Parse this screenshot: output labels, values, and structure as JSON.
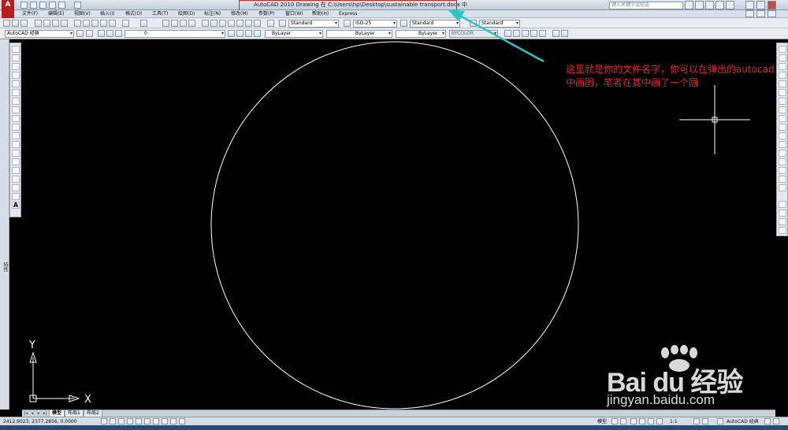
{
  "window": {
    "title": "AutoCAD 2010     Drawing 在 C:\\Users\\hp\\Desktop\\sustainable transport.docx 中",
    "search_placeholder": "键入关键字或短语",
    "logo_letter": "A"
  },
  "menu": {
    "items": [
      "文件(F)",
      "编辑(E)",
      "视图(V)",
      "插入(I)",
      "格式(O)",
      "工具(T)",
      "绘图(D)",
      "标注(N)",
      "修改(M)",
      "参数(P)",
      "窗口(W)",
      "帮助(H)",
      "Express"
    ]
  },
  "toolbar1": {
    "text_style": "Standard",
    "dim_style": "ISO-25",
    "table_style": "Standard",
    "multileader_style": "Standard"
  },
  "toolbar2": {
    "workspace": "AutoCAD 经典",
    "layer": "0",
    "color": "ByLayer",
    "linetype": "ByLayer",
    "lineweight": "ByLayer",
    "plotstyle": "BYCOLOR"
  },
  "left_panel": {
    "label": "特性"
  },
  "canvas": {
    "background": "#000000",
    "circle_color": "#ffffff",
    "ucs_x_label": "X",
    "ucs_y_label": "Y"
  },
  "annotation": {
    "text": "这里就是你的文件名字，你可以在弹出的autocad中画图，笔者在其中画了一个圆",
    "color": "#e0242a",
    "arrow_color": "#2bc6c9"
  },
  "layout_tabs": {
    "items": [
      "模型",
      "布局1",
      "布局2"
    ],
    "active": "模型"
  },
  "status": {
    "coordinates": "2412.9023, 2377.2856, 0.0000",
    "model_label": "模型",
    "scale": "1:1",
    "workspace": "AutoCAD 经典"
  },
  "watermark": {
    "brand": "Bai du 经验",
    "url": "jingyan.baidu.com"
  }
}
